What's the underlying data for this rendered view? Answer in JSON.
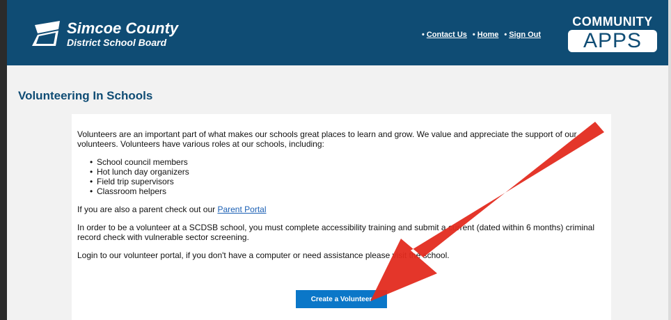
{
  "header": {
    "logo_line1": "Simcoe County",
    "logo_line2": "District School Board",
    "nav": [
      {
        "label": "Contact Us"
      },
      {
        "label": "Home"
      },
      {
        "label": "Sign Out"
      }
    ],
    "apps_top": "COMMUNITY",
    "apps_bottom": "APPS"
  },
  "page": {
    "title": "Volunteering In Schools",
    "intro": "Volunteers are an important part of what makes our schools great places to learn and grow. We value and appreciate the support of our volunteers. Volunteers have various roles at our schools, including:",
    "roles": [
      "School council members",
      "Hot lunch day organizers",
      "Field trip supervisors",
      "Classroom helpers"
    ],
    "parent_prefix": "If you are also a parent check out our ",
    "parent_link": "Parent Portal",
    "requirements": "In order to be a volunteer at a SCDSB school, you must complete accessibility training and submit a current (dated within 6 months) criminal record check with vulnerable sector screening.",
    "login_text": "Login to our volunteer portal, if you don't have a computer or need assistance please visit the school.",
    "create_button": "Create a Volunteer"
  },
  "colors": {
    "header_bg": "#0f4c74",
    "title": "#0f4c74",
    "button": "#0b77c8",
    "arrow": "#e32b1f"
  }
}
